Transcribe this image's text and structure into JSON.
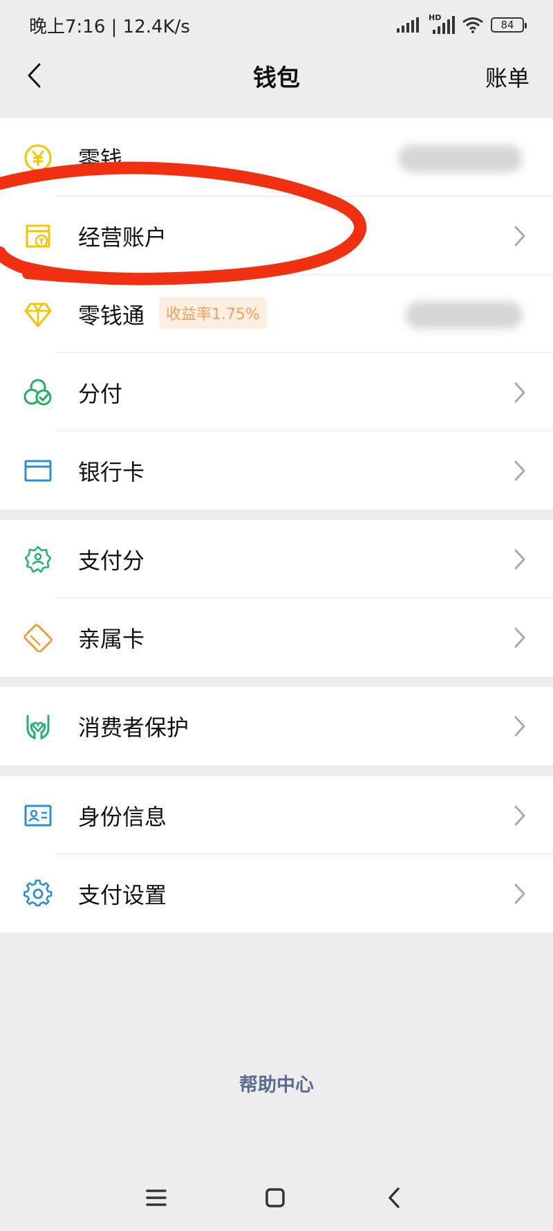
{
  "status_bar": {
    "time_speed": "晚上7:16 | 12.4K/s",
    "signal_icons": [
      "signal-icon",
      "hd-signal-icon",
      "wifi-icon"
    ],
    "hd_label": "HD",
    "battery": "84"
  },
  "nav": {
    "title": "钱包",
    "right_action": "账单"
  },
  "groups": [
    {
      "items": [
        {
          "label": "零钱",
          "icon": "yuan-coin-icon",
          "color": "#f5c400",
          "amount_blurred": true
        },
        {
          "label": "经营账户",
          "icon": "shop-account-icon",
          "color": "#f5c400"
        },
        {
          "label": "零钱通",
          "icon": "diamond-icon",
          "color": "#f5c400",
          "badge": "收益率1.75%",
          "amount_blurred": true
        },
        {
          "label": "分付",
          "icon": "fenfu-icon",
          "color": "#20b060"
        },
        {
          "label": "银行卡",
          "icon": "bank-card-icon",
          "color": "#2a8fd0"
        }
      ]
    },
    {
      "items": [
        {
          "label": "支付分",
          "icon": "pay-score-icon",
          "color": "#20b070"
        },
        {
          "label": "亲属卡",
          "icon": "family-card-icon",
          "color": "#e8a040"
        }
      ]
    },
    {
      "items": [
        {
          "label": "消费者保护",
          "icon": "consumer-protect-icon",
          "color": "#20b070"
        }
      ]
    },
    {
      "items": [
        {
          "label": "身份信息",
          "icon": "id-card-icon",
          "color": "#2a8fd0"
        },
        {
          "label": "支付设置",
          "icon": "gear-icon",
          "color": "#2a8fd0"
        }
      ]
    }
  ],
  "help_center": "帮助中心",
  "annotation_color": "#f03010"
}
